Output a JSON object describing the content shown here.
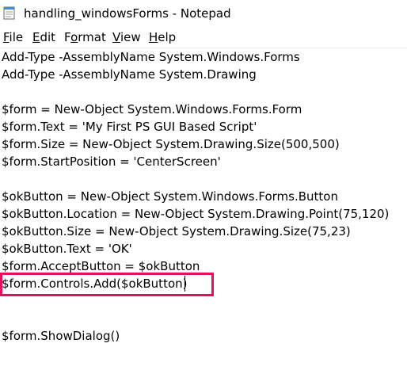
{
  "window": {
    "title": "handling_windowsForms - Notepad",
    "icon": "notepad-icon"
  },
  "menu": {
    "file": {
      "prefix": "",
      "mnemonic": "F",
      "rest": "ile"
    },
    "edit": {
      "prefix": "",
      "mnemonic": "E",
      "rest": "dit"
    },
    "format": {
      "prefix": "F",
      "mnemonic": "o",
      "rest": "rmat"
    },
    "view": {
      "prefix": "",
      "mnemonic": "V",
      "rest": "iew"
    },
    "help": {
      "prefix": "",
      "mnemonic": "H",
      "rest": "elp"
    }
  },
  "editor": {
    "lines": [
      "Add-Type -AssemblyName System.Windows.Forms",
      "Add-Type -AssemblyName System.Drawing",
      "",
      "$form = New-Object System.Windows.Forms.Form",
      "$form.Text = 'My First PS GUI Based Script'",
      "$form.Size = New-Object System.Drawing.Size(500,500)",
      "$form.StartPosition = 'CenterScreen'",
      "",
      "$okButton = New-Object System.Windows.Forms.Button",
      "$okButton.Location = New-Object System.Drawing.Point(75,120)",
      "$okButton.Size = New-Object System.Drawing.Size(75,23)",
      "$okButton.Text = 'OK'",
      "$form.AcceptButton = $okButton",
      "$form.Controls.Add($okButton)",
      "",
      "",
      "$form.ShowDialog()"
    ],
    "highlight_color": "#e0115f"
  }
}
